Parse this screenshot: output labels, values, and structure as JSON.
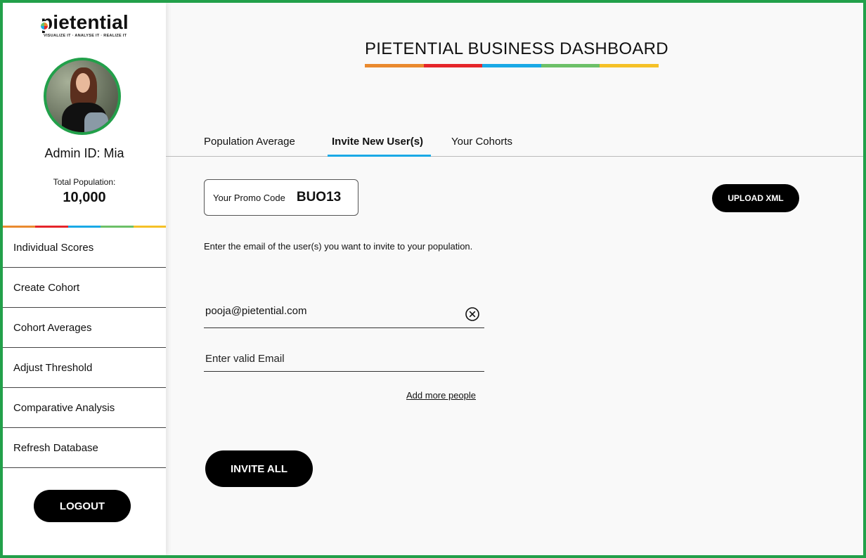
{
  "brand": {
    "name": "pietential",
    "tagline": "VISUALIZE IT · ANALYSE IT · REALIZE IT"
  },
  "profile": {
    "admin_id": "Admin ID: Mia",
    "population_label": "Total Population:",
    "population_value": "10,000"
  },
  "palette": [
    "#ea8a2f",
    "#e5252a",
    "#1aa9e6",
    "#6cc068",
    "#f5c127"
  ],
  "sidebar": {
    "items": [
      {
        "label": "Individual Scores"
      },
      {
        "label": "Create Cohort"
      },
      {
        "label": "Cohort Averages"
      },
      {
        "label": "Adjust Threshold"
      },
      {
        "label": "Comparative Analysis"
      },
      {
        "label": "Refresh Database"
      }
    ],
    "logout_label": "LOGOUT"
  },
  "header": {
    "title": "PIETENTIAL BUSINESS DASHBOARD"
  },
  "tabs": [
    {
      "label": "Population Average",
      "active": false
    },
    {
      "label": "Invite New User(s)",
      "active": true
    },
    {
      "label": "Your Cohorts",
      "active": false
    }
  ],
  "promo": {
    "label": "Your Promo Code",
    "code": "BUO13"
  },
  "upload_label": "UPLOAD XML",
  "instructions": "Enter the email of the user(s) you want to invite to your population.",
  "emails": [
    {
      "value": "pooja@pietential.com",
      "placeholder": ""
    },
    {
      "value": "",
      "placeholder": "Enter valid Email"
    }
  ],
  "add_more_label": "Add more people",
  "invite_label": "INVITE ALL",
  "icons": {
    "clear": "clear-circle-x-icon"
  }
}
